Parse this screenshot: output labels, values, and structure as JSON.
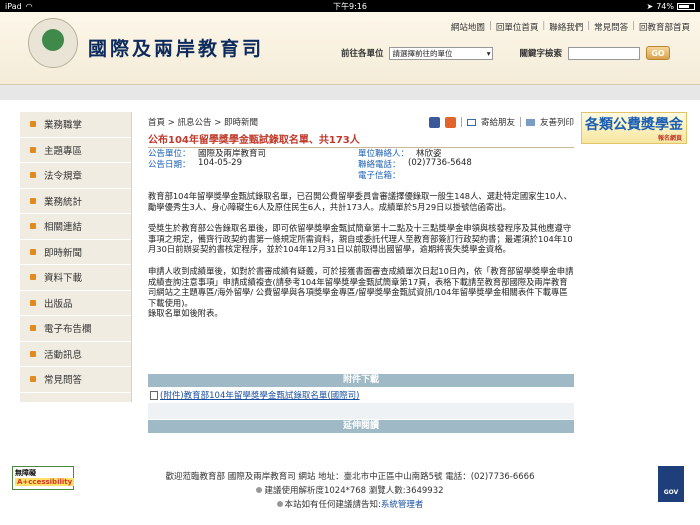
{
  "status_bar": {
    "device": "iPad",
    "time": "下午9:16",
    "battery": "74%",
    "battery_level": 0.74
  },
  "header": {
    "site_title": "國際及兩岸教育司",
    "top_links": [
      "網站地圖",
      "回單位首頁",
      "聯絡我們",
      "常見問答",
      "回教育部首頁"
    ],
    "unit_label": "前往各單位",
    "unit_select": "請選擇前往的單位",
    "keyword_label": "關鍵字檢索",
    "go_button": "GO"
  },
  "sidebar": {
    "items": [
      "業務職掌",
      "主題專區",
      "法令規章",
      "業務統計",
      "相關連結",
      "即時新聞",
      "資料下載",
      "出版品",
      "電子布告欄",
      "活動訊息",
      "常見問答"
    ]
  },
  "breadcrumb": "首頁 > 訊息公告 > 即時新聞",
  "share": {
    "mail": "寄給朋友",
    "print": "友善列印"
  },
  "article": {
    "title": "公布104年留學獎學金甄試錄取名單、共173人",
    "meta": {
      "unit_key": "公告單位：",
      "unit_val": "國際及兩岸教育司",
      "date_key": "公告日期：",
      "date_val": "104-05-29",
      "contact_key": "單位聯絡人：",
      "contact_val": "林欣姿",
      "phone_key": "聯絡電話：",
      "phone_val": "(02)7736-5648",
      "email_key": "電子信箱：",
      "email_val": ""
    },
    "paragraphs": [
      "教育部104年留學獎學金甄試錄取名單，已召開公費留學委員會審議擇優錄取一般生148人、選赴特定國家生10人、勵學優秀生3人、身心障礙生6人及原住民生6人，共計173人。成績單於5月29日以掛號信函寄出。",
      "受獎生於教育部公告錄取名單後，即可依留學獎學金甄試簡章第十二點及十三點獎學金申領與核發程序及其他應遵守事項之規定，備齊行政契約書第一條規定所需資料，親自或委託代理人至教育部簽訂行政契約書；最遲須於104年10月30日前辦妥契約書核定程序，並於104年12月31日以前取得出國留學，逾期將喪失獎學金資格。",
      "申請人收到成績單後，如對於書審成績有疑義，可於接獲書面審查成績單次日起10日內，依「教育部留學獎學金申請成績查詢注意事項」申請成績複查(請參考104年留學獎學金甄試簡章第17頁，表格下載請至教育部國際及兩岸教育司網站之主題專區/海外留學/ 公費留學與各項獎學金專區/留學獎學金甄試資訊/104年留學獎學金相關表件下載專區下載使用)。",
      "錄取名單如後附表。"
    ]
  },
  "attachments": {
    "header": "附件下載",
    "files": [
      "(附件)教育部104年留學獎學金甄試錄取名單(國際司)"
    ]
  },
  "extended": {
    "header": "延伸閱讀"
  },
  "banner": {
    "main": "各類公費獎學金",
    "sub": "報名網頁"
  },
  "footer": {
    "line1": "歡迎蒞臨教育部 國際及兩岸教育司 網站 地址：臺北市中正區中山南路5號 電話：(02)7736-6666",
    "line2": "建議使用解析度1024*768 瀏覽人數:3649932",
    "line3_prefix": "本站如有任何建議請告知:",
    "line3_link": "系統管理者",
    "accessibility_badge_1": "無障礙",
    "accessibility_badge_2": "A+ccessibility",
    "gov_badge": "GOV"
  }
}
